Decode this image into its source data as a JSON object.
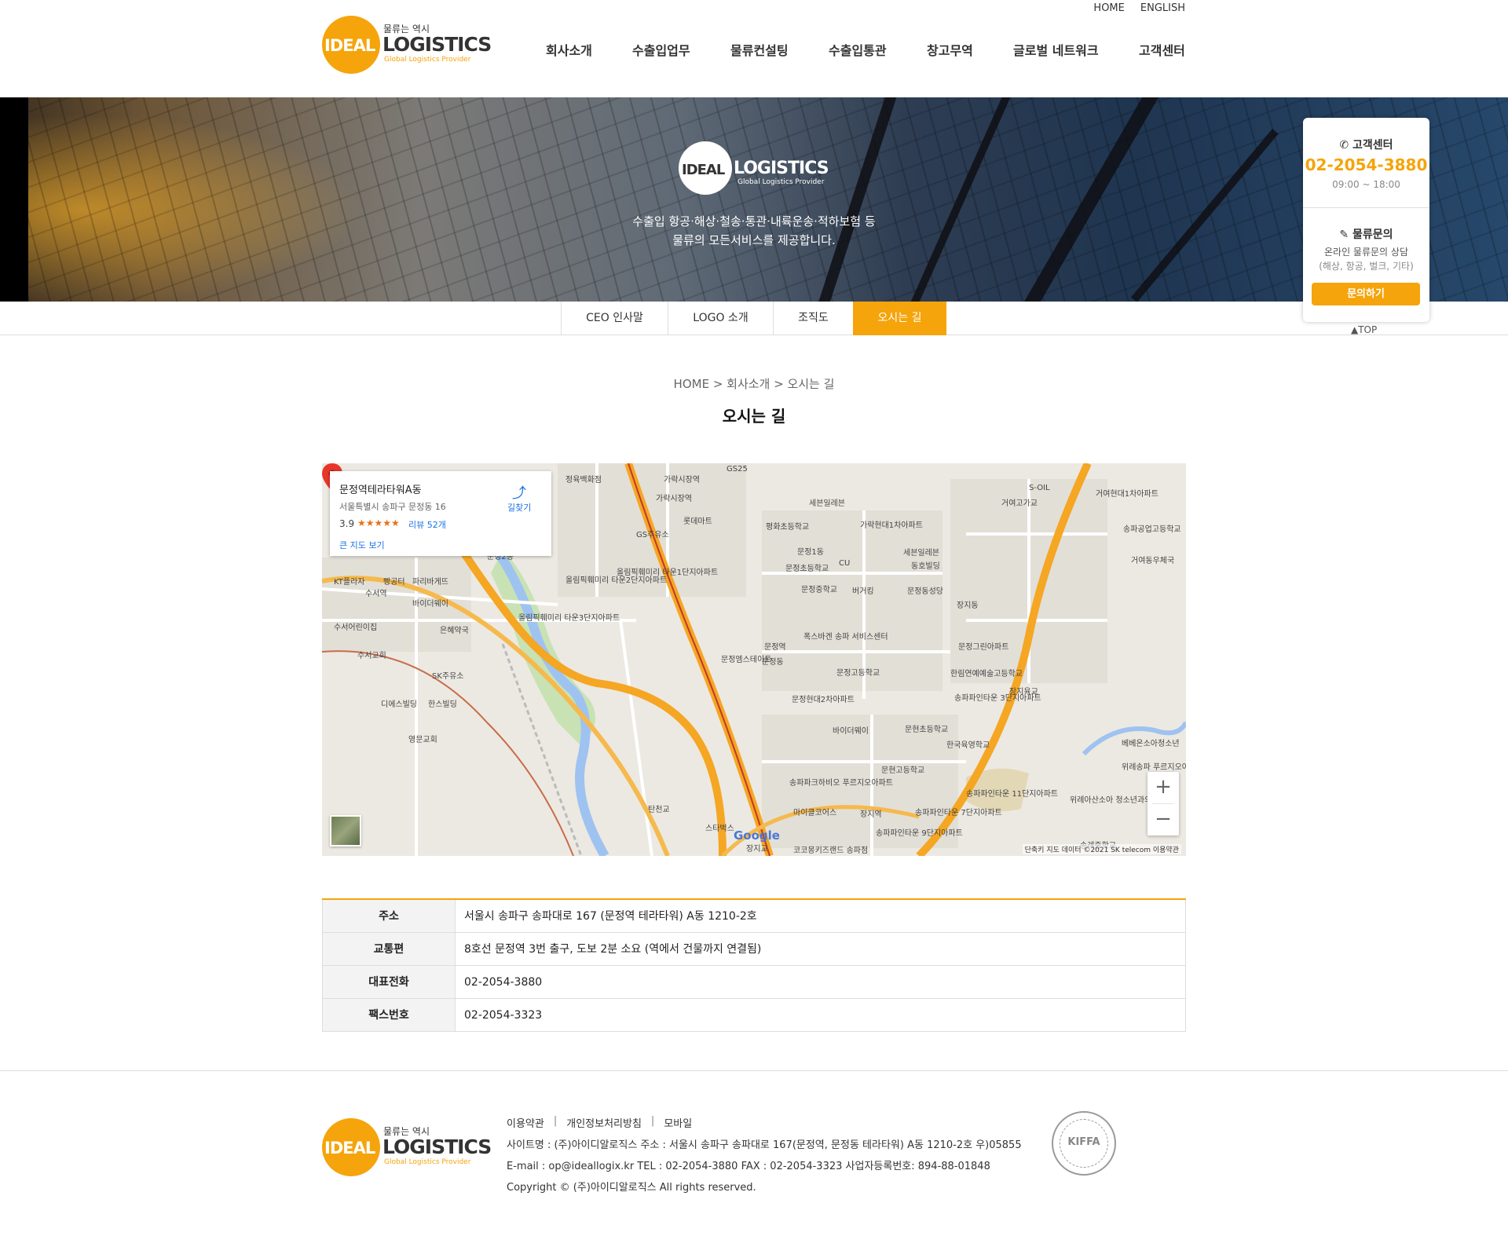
{
  "util": {
    "home": "HOME",
    "english": "ENGLISH"
  },
  "logo": {
    "small": "물류는 역시",
    "ideal": "IDEAL",
    "main": "LOGISTICS",
    "tagline": "Global Logistics Provider"
  },
  "nav": [
    "회사소개",
    "수출입업무",
    "물류컨설팅",
    "수출입통관",
    "창고무역",
    "글로벌 네트워크",
    "고객센터"
  ],
  "banner": {
    "logo_ideal": "IDEAL",
    "logo_main": "LOGISTICS",
    "logo_tagline": "Global Logistics Provider",
    "line1": "수출입 항공·해상·철송·통관·내륙운송·적하보험 등",
    "line2": "물류의 모든서비스를 제공합니다."
  },
  "subtabs": [
    "CEO 인사말",
    "LOGO 소개",
    "조직도",
    "오시는 길"
  ],
  "quick": {
    "cs_title": "고객센터",
    "phone": "02-2054-3880",
    "hours": "09:00 ~ 18:00",
    "inquiry_title": "물류문의",
    "inquiry_desc1": "온라인 물류문의 상담",
    "inquiry_desc2": "(해상, 항공, 벌크, 기타)",
    "inquiry_button": "문의하기",
    "top": "▲TOP"
  },
  "breadcrumb": "HOME > 회사소개 > 오시는 길",
  "page_title": "오시는 길",
  "map": {
    "place_name": "문정역테라타워A동",
    "place_address": "서울특별시 송파구 문정동 16",
    "rating": "3.9",
    "stars": "★★★★★",
    "reviews": "리뷰 52개",
    "bigger_map": "큰 지도 보기",
    "directions": "길찾기",
    "zoom_in": "+",
    "zoom_out": "−",
    "google": "Google",
    "attribution": "단축키   지도 데이터 ©2021 SK telecom   이용약관",
    "labels": [
      "정육백화점",
      "가락시장역",
      "가락시장역",
      "롯데마트",
      "GS주유소",
      "평화초등학교",
      "세븐일레븐",
      "가락현대1차아파트",
      "S-OIL",
      "거여고가교",
      "거여현대1차아파트",
      "송파공업고등학교",
      "거여동우체국",
      "올림픽훼미리 타운2단지아파트",
      "올림픽훼미리 타운1단지아파트",
      "올림픽훼미리 타운3단지아파트",
      "문정초등학교",
      "문정중학교",
      "버거킹",
      "문정동성당",
      "세븐일레븐",
      "동호빌딩",
      "KT플라자",
      "수서역",
      "빵공터",
      "파리바게뜨",
      "바이더웨이",
      "수서어린이집",
      "수서교회",
      "은혜약국",
      "SK주유소",
      "디에스빌딩",
      "한스빌딩",
      "영문교회",
      "문정역",
      "문정엠스테이트",
      "폭스바겐 송파 서비스센터",
      "문정고등학교",
      "문정현대2차아파트",
      "한림연예예술고등학교",
      "송파파인타운 3단지아파트",
      "장지육교",
      "바이더웨이",
      "문현초등학교",
      "한국육영학교",
      "베베온소아청소년",
      "위례송파 푸르지오아파트",
      "문현고등학교",
      "송파파크하비오 푸르지오아파트",
      "송파파인타운 11단지아파트",
      "송파파인타운 7단지아파트",
      "송파파인타운 9단지아파트",
      "장지역",
      "코코몽키즈랜드 송파점",
      "탄천교",
      "스타벅스",
      "장지교",
      "위례아산소아 청소년과의원",
      "송례중학교",
      "GS25",
      "CU",
      "문정2동",
      "문정1동",
      "문정동",
      "장지동",
      "마이클코어스",
      "문정그린아파트"
    ]
  },
  "info": [
    {
      "label": "주소",
      "value": "서울시 송파구 송파대로 167 (문정역 테라타워) A동 1210-2호"
    },
    {
      "label": "교통편",
      "value": "8호선 문정역 3번 출구, 도보 2분 소요 (역에서 건물까지 연결됨)"
    },
    {
      "label": "대표전화",
      "value": "02-2054-3880"
    },
    {
      "label": "팩스번호",
      "value": "02-2054-3323"
    }
  ],
  "footer": {
    "links": [
      "이용약관",
      "개인정보처리방침",
      "모바일"
    ],
    "link_sep": "|",
    "line1": "사이트명 : (주)아이디알로직스   주소 : 서울시 송파구 송파대로 167(문정역, 문정동 테라타워) A동 1210-2호 우)05855",
    "line2": "E-mail : op@ideallogix.kr   TEL : 02-2054-3880   FAX : 02-2054-3323   사업자등록번호: 894-88-01848",
    "line3": "Copyright © (주)아이디알로직스 All rights reserved.",
    "kiffa": "KIFFA"
  },
  "colors": {
    "accent": "#f5a40b",
    "link": "#1a73e8"
  }
}
